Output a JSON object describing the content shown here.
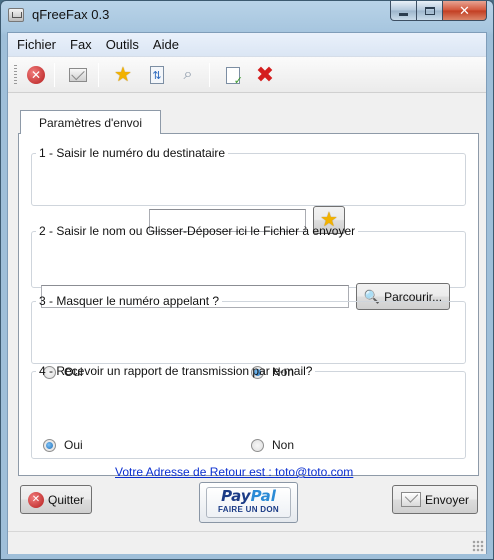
{
  "window": {
    "title": "qFreeFax 0.3"
  },
  "menu": [
    "Fichier",
    "Fax",
    "Outils",
    "Aide"
  ],
  "toolbar": {
    "icons": [
      "stop-icon",
      "mail-icon",
      "star-icon",
      "refresh-icon",
      "search-icon",
      "document-check-icon",
      "delete-x-icon"
    ]
  },
  "tab": {
    "label": "Paramètres d'envoi"
  },
  "section1": {
    "legend": "1 - Saisir le numéro du destinataire",
    "number_value": ""
  },
  "section2": {
    "legend": "2 - Saisir le nom ou Glisser-Déposer ici le Fichier à envoyer",
    "file_value": "",
    "browse_label": "Parcourir..."
  },
  "section3": {
    "legend": "3 - Masquer le numéro appelant ?",
    "opt_yes": "Oui",
    "opt_no": "Non",
    "selected": "Non"
  },
  "section4": {
    "legend": "4 - Recevoir un rapport de transmission par e-mail?",
    "opt_yes": "Oui",
    "opt_no": "Non",
    "selected": "Oui",
    "return_link": "Votre Adresse de Retour est : toto@toto.com"
  },
  "footer": {
    "quit_label": "Quitter",
    "paypal_pay": "Pay",
    "paypal_pal": "Pal",
    "paypal_sub": "FAIRE UN DON",
    "send_label": "Envoyer"
  },
  "colors": {
    "link": "#0b2fd0",
    "close_button": "#c23e22",
    "accent_blue": "#1f6fb9"
  }
}
